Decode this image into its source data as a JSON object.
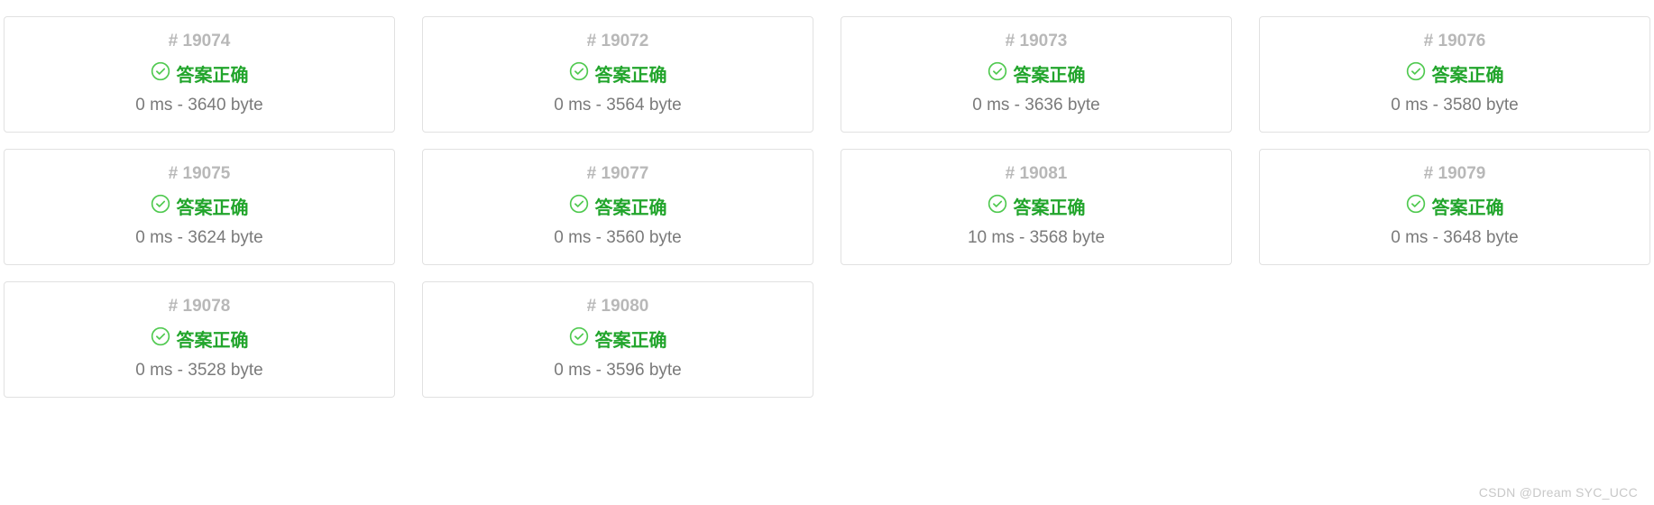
{
  "status_label": "答案正确",
  "id_prefix": "# ",
  "cards": [
    {
      "id": "19074",
      "time": "0 ms",
      "size": "3640 byte"
    },
    {
      "id": "19072",
      "time": "0 ms",
      "size": "3564 byte"
    },
    {
      "id": "19073",
      "time": "0 ms",
      "size": "3636 byte"
    },
    {
      "id": "19076",
      "time": "0 ms",
      "size": "3580 byte"
    },
    {
      "id": "19075",
      "time": "0 ms",
      "size": "3624 byte"
    },
    {
      "id": "19077",
      "time": "0 ms",
      "size": "3560 byte"
    },
    {
      "id": "19081",
      "time": "10 ms",
      "size": "3568 byte"
    },
    {
      "id": "19079",
      "time": "0 ms",
      "size": "3648 byte"
    },
    {
      "id": "19078",
      "time": "0 ms",
      "size": "3528 byte"
    },
    {
      "id": "19080",
      "time": "0 ms",
      "size": "3596 byte"
    }
  ],
  "watermark": "CSDN @Dream SYC_UCC",
  "colors": {
    "success": "#22a52c",
    "id_text": "#b8b8b8",
    "meta_text": "#7a7a7a",
    "border": "#e1e1e1"
  }
}
